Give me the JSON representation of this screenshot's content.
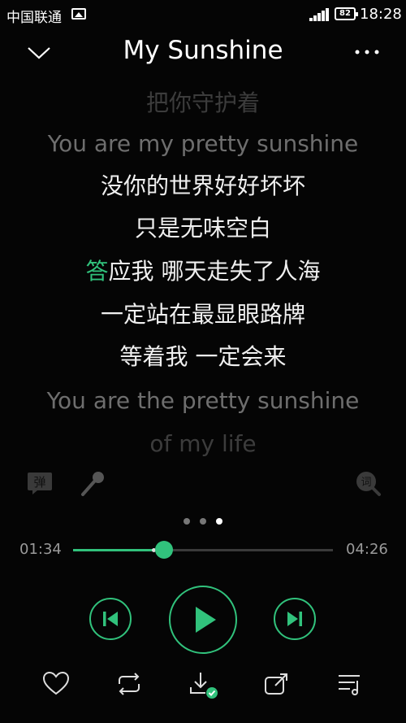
{
  "status": {
    "carrier": "中国联通",
    "battery": "82",
    "time": "18:28"
  },
  "header": {
    "title": "My Sunshine",
    "back_icon": "chevron-down-icon",
    "more_icon": "more-dots-icon"
  },
  "lyrics": {
    "lines": [
      "把你守护着",
      "You are my pretty sunshine",
      "没你的世界好好坏坏",
      "只是无味空白",
      "应我 哪天走失了人海",
      "一定站在最显眼路牌",
      "等着我  一定会来",
      "You are the pretty sunshine",
      "of my life"
    ],
    "active_char": "答"
  },
  "tools": {
    "danmu_label": "弹",
    "lyric_label": "词"
  },
  "pager": {
    "count": 3,
    "active_index": 2
  },
  "player": {
    "current_time": "01:34",
    "total_time": "04:26",
    "progress": 0.35,
    "buffered": 0.31
  },
  "colors": {
    "accent": "#31c27c",
    "background": "#050505"
  }
}
